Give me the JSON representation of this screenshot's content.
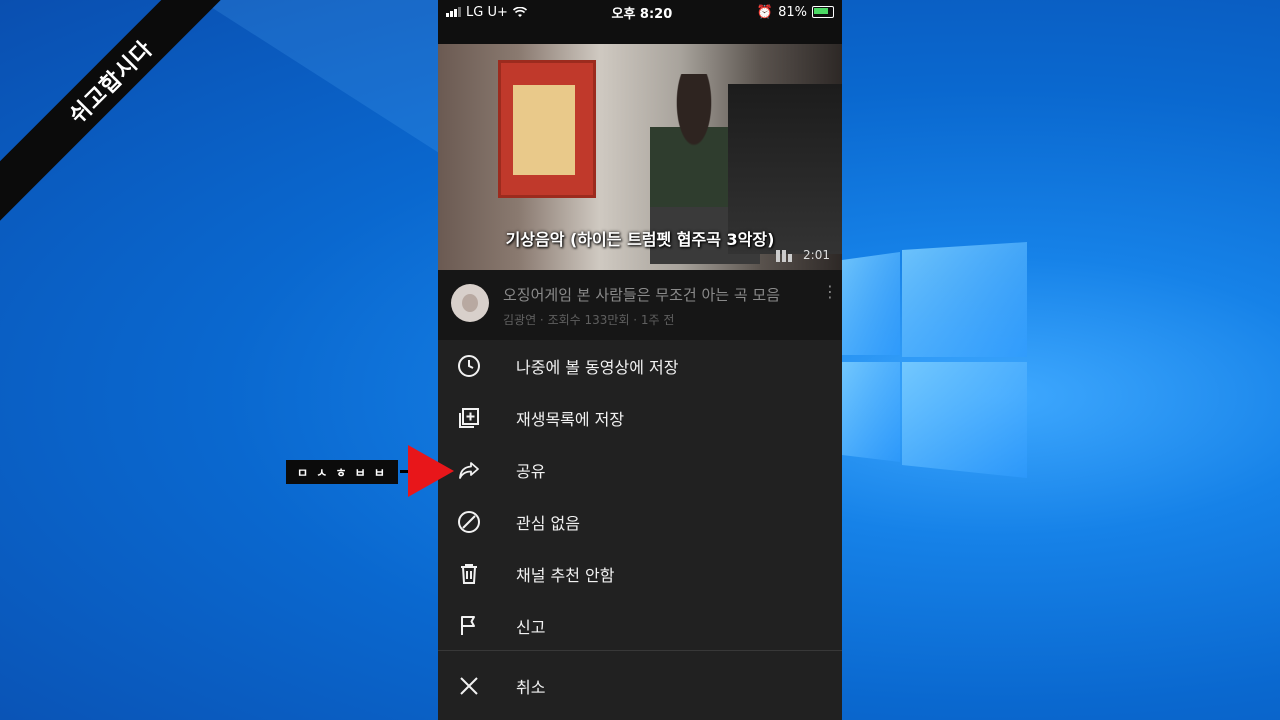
{
  "watermark": {
    "text": "쉬고합시다"
  },
  "status_bar": {
    "carrier": "LG U+",
    "time": "오후 8:20",
    "battery": "81%"
  },
  "video": {
    "caption": "기상음악 (하이든 트럼펫 협주곡 3악장)",
    "duration": "2:01",
    "title": "오징어게임 본 사람들은 무조건 아는 곡 모음",
    "meta": "김광연 · 조회수 133만회 · 1주 전"
  },
  "menu": {
    "items": [
      {
        "label": "나중에 볼 동영상에 저장",
        "icon": "clock-icon"
      },
      {
        "label": "재생목록에 저장",
        "icon": "playlist-add-icon"
      },
      {
        "label": "공유",
        "icon": "share-icon"
      },
      {
        "label": "관심 없음",
        "icon": "not-interested-icon"
      },
      {
        "label": "채널 추천 안함",
        "icon": "trash-icon"
      },
      {
        "label": "신고",
        "icon": "flag-icon"
      }
    ],
    "cancel_label": "취소"
  },
  "callout": {
    "text": "ㅁ ㅅ ㅎ ㅂ ㅂ"
  },
  "colors": {
    "desktop_blue": "#0a6fd8",
    "sheet_bg": "#212121",
    "arrow_red": "#e8161a"
  }
}
